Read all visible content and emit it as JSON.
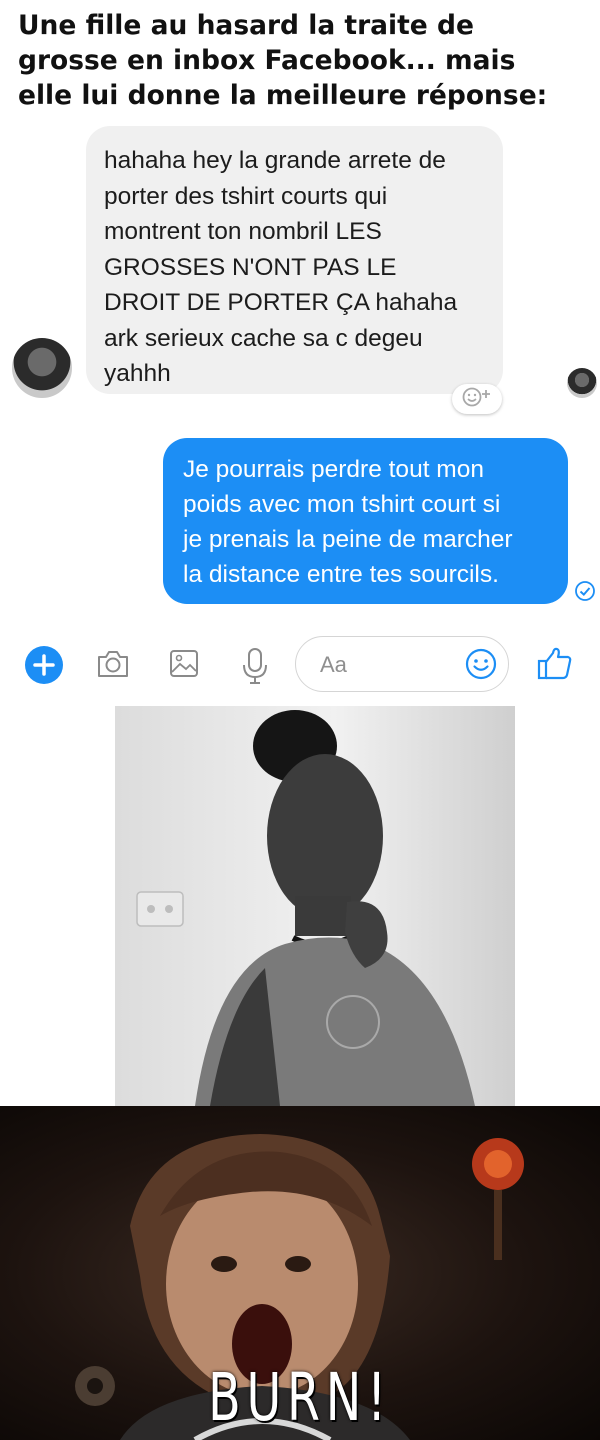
{
  "headline": {
    "lines": [
      "Une fille au hasard la traite de",
      "grosse en inbox Facebook... mais",
      "elle lui donne la meilleure réponse:"
    ]
  },
  "conversation": {
    "incoming": {
      "lines": [
        "hahaha hey la grande arrete de",
        "porter des tshirt courts qui",
        "montrent ton nombril LES",
        "GROSSES N'ONT PAS LE",
        "DROIT DE PORTER ÇA hahaha",
        "ark serieux cache sa c degeu",
        "yahhh"
      ],
      "reaction_icon": "add-reaction-icon"
    },
    "outgoing": {
      "lines": [
        "Je pourrais perdre tout mon",
        "poids avec mon tshirt court si",
        "je prenais la peine de marcher",
        "la distance entre tes sourcils."
      ],
      "status_icon": "seen-check-icon"
    }
  },
  "composer": {
    "placeholder": "Aa",
    "tools": [
      "plus-icon",
      "camera-icon",
      "gallery-icon",
      "microphone-icon",
      "emoji-icon",
      "thumbs-up-icon"
    ]
  },
  "gif": {
    "caption": "BURN!"
  },
  "colors": {
    "messenger_blue": "#1c8ef5",
    "incoming_bubble": "#f0f0f0",
    "headline_text": "#111111"
  }
}
